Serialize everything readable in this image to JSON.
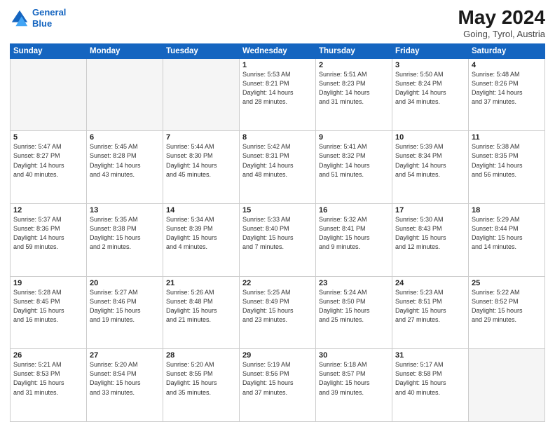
{
  "header": {
    "logo_line1": "General",
    "logo_line2": "Blue",
    "month": "May 2024",
    "location": "Going, Tyrol, Austria"
  },
  "days_of_week": [
    "Sunday",
    "Monday",
    "Tuesday",
    "Wednesday",
    "Thursday",
    "Friday",
    "Saturday"
  ],
  "weeks": [
    [
      {
        "num": "",
        "info": ""
      },
      {
        "num": "",
        "info": ""
      },
      {
        "num": "",
        "info": ""
      },
      {
        "num": "1",
        "info": "Sunrise: 5:53 AM\nSunset: 8:21 PM\nDaylight: 14 hours\nand 28 minutes."
      },
      {
        "num": "2",
        "info": "Sunrise: 5:51 AM\nSunset: 8:23 PM\nDaylight: 14 hours\nand 31 minutes."
      },
      {
        "num": "3",
        "info": "Sunrise: 5:50 AM\nSunset: 8:24 PM\nDaylight: 14 hours\nand 34 minutes."
      },
      {
        "num": "4",
        "info": "Sunrise: 5:48 AM\nSunset: 8:26 PM\nDaylight: 14 hours\nand 37 minutes."
      }
    ],
    [
      {
        "num": "5",
        "info": "Sunrise: 5:47 AM\nSunset: 8:27 PM\nDaylight: 14 hours\nand 40 minutes."
      },
      {
        "num": "6",
        "info": "Sunrise: 5:45 AM\nSunset: 8:28 PM\nDaylight: 14 hours\nand 43 minutes."
      },
      {
        "num": "7",
        "info": "Sunrise: 5:44 AM\nSunset: 8:30 PM\nDaylight: 14 hours\nand 45 minutes."
      },
      {
        "num": "8",
        "info": "Sunrise: 5:42 AM\nSunset: 8:31 PM\nDaylight: 14 hours\nand 48 minutes."
      },
      {
        "num": "9",
        "info": "Sunrise: 5:41 AM\nSunset: 8:32 PM\nDaylight: 14 hours\nand 51 minutes."
      },
      {
        "num": "10",
        "info": "Sunrise: 5:39 AM\nSunset: 8:34 PM\nDaylight: 14 hours\nand 54 minutes."
      },
      {
        "num": "11",
        "info": "Sunrise: 5:38 AM\nSunset: 8:35 PM\nDaylight: 14 hours\nand 56 minutes."
      }
    ],
    [
      {
        "num": "12",
        "info": "Sunrise: 5:37 AM\nSunset: 8:36 PM\nDaylight: 14 hours\nand 59 minutes."
      },
      {
        "num": "13",
        "info": "Sunrise: 5:35 AM\nSunset: 8:38 PM\nDaylight: 15 hours\nand 2 minutes."
      },
      {
        "num": "14",
        "info": "Sunrise: 5:34 AM\nSunset: 8:39 PM\nDaylight: 15 hours\nand 4 minutes."
      },
      {
        "num": "15",
        "info": "Sunrise: 5:33 AM\nSunset: 8:40 PM\nDaylight: 15 hours\nand 7 minutes."
      },
      {
        "num": "16",
        "info": "Sunrise: 5:32 AM\nSunset: 8:41 PM\nDaylight: 15 hours\nand 9 minutes."
      },
      {
        "num": "17",
        "info": "Sunrise: 5:30 AM\nSunset: 8:43 PM\nDaylight: 15 hours\nand 12 minutes."
      },
      {
        "num": "18",
        "info": "Sunrise: 5:29 AM\nSunset: 8:44 PM\nDaylight: 15 hours\nand 14 minutes."
      }
    ],
    [
      {
        "num": "19",
        "info": "Sunrise: 5:28 AM\nSunset: 8:45 PM\nDaylight: 15 hours\nand 16 minutes."
      },
      {
        "num": "20",
        "info": "Sunrise: 5:27 AM\nSunset: 8:46 PM\nDaylight: 15 hours\nand 19 minutes."
      },
      {
        "num": "21",
        "info": "Sunrise: 5:26 AM\nSunset: 8:48 PM\nDaylight: 15 hours\nand 21 minutes."
      },
      {
        "num": "22",
        "info": "Sunrise: 5:25 AM\nSunset: 8:49 PM\nDaylight: 15 hours\nand 23 minutes."
      },
      {
        "num": "23",
        "info": "Sunrise: 5:24 AM\nSunset: 8:50 PM\nDaylight: 15 hours\nand 25 minutes."
      },
      {
        "num": "24",
        "info": "Sunrise: 5:23 AM\nSunset: 8:51 PM\nDaylight: 15 hours\nand 27 minutes."
      },
      {
        "num": "25",
        "info": "Sunrise: 5:22 AM\nSunset: 8:52 PM\nDaylight: 15 hours\nand 29 minutes."
      }
    ],
    [
      {
        "num": "26",
        "info": "Sunrise: 5:21 AM\nSunset: 8:53 PM\nDaylight: 15 hours\nand 31 minutes."
      },
      {
        "num": "27",
        "info": "Sunrise: 5:20 AM\nSunset: 8:54 PM\nDaylight: 15 hours\nand 33 minutes."
      },
      {
        "num": "28",
        "info": "Sunrise: 5:20 AM\nSunset: 8:55 PM\nDaylight: 15 hours\nand 35 minutes."
      },
      {
        "num": "29",
        "info": "Sunrise: 5:19 AM\nSunset: 8:56 PM\nDaylight: 15 hours\nand 37 minutes."
      },
      {
        "num": "30",
        "info": "Sunrise: 5:18 AM\nSunset: 8:57 PM\nDaylight: 15 hours\nand 39 minutes."
      },
      {
        "num": "31",
        "info": "Sunrise: 5:17 AM\nSunset: 8:58 PM\nDaylight: 15 hours\nand 40 minutes."
      },
      {
        "num": "",
        "info": ""
      }
    ]
  ]
}
